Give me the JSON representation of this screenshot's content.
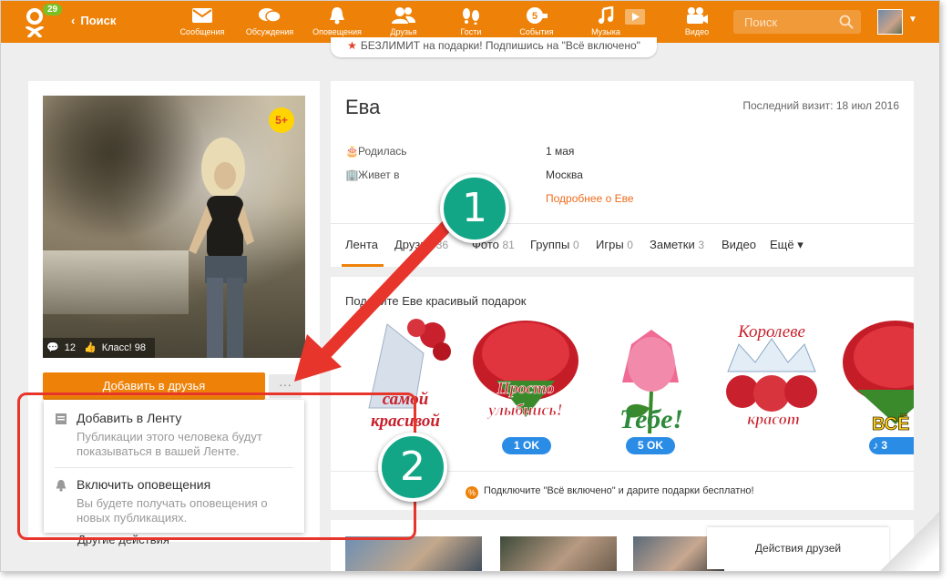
{
  "topbar": {
    "notification_count": "29",
    "back_label": "Поиск",
    "nav": [
      {
        "label": "Сообщения",
        "icon": "envelope-icon"
      },
      {
        "label": "Обсуждения",
        "icon": "chat-bubbles-icon"
      },
      {
        "label": "Оповещения",
        "icon": "bell-icon"
      },
      {
        "label": "Друзья",
        "icon": "friends-icon"
      },
      {
        "label": "Гости",
        "icon": "footprints-icon"
      },
      {
        "label": "События",
        "icon": "events-icon"
      },
      {
        "label": "Музыка",
        "icon": "music-note-icon"
      },
      {
        "label": "Видео",
        "icon": "video-camera-icon"
      }
    ],
    "search_placeholder": "Поиск"
  },
  "promo": {
    "text": "БЕЗЛИМИТ на подарки! Подпишись на \"Всё включено\""
  },
  "profile": {
    "photo_badge": "5+",
    "comments_count": "12",
    "likes_label": "Класс! 98",
    "add_friend_label": "Добавить в друзья",
    "more_label": "···",
    "name": "Ева",
    "last_visit": "Последний визит: 18 июл 2016",
    "born_label": "Родилась",
    "born_value": "1 мая",
    "lives_label": "Живет в",
    "lives_value": "Москва",
    "more_about": "Подробнее о Еве"
  },
  "dropdown": {
    "item1_title": "Добавить в Ленту",
    "item1_desc_line1": "Публикации этого человека будут",
    "item1_desc_line2": "показываться в вашей Ленте.",
    "item2_title": "Включить оповещения",
    "item2_desc_line1": "Вы будете получать оповещения о",
    "item2_desc_line2": "новых публикациях.",
    "other_actions": "Другие действия"
  },
  "tabs": [
    {
      "label": "Лента",
      "count": ""
    },
    {
      "label": "Друзья",
      "count": "36"
    },
    {
      "label": "Фото",
      "count": "81"
    },
    {
      "label": "Группы",
      "count": "0"
    },
    {
      "label": "Игры",
      "count": "0"
    },
    {
      "label": "Заметки",
      "count": "3"
    },
    {
      "label": "Видео",
      "count": ""
    },
    {
      "label": "Ещё ▾",
      "count": ""
    }
  ],
  "gifts": {
    "title": "Подарите Еве красивый подарок",
    "items": [
      {
        "caption": "Самой красивой",
        "badge": ""
      },
      {
        "caption": "Просто улыбнись!",
        "badge": "1 OK"
      },
      {
        "caption": "Тебе!",
        "badge": "5 OK"
      },
      {
        "caption": "Королеве красот",
        "badge": ""
      },
      {
        "caption": "ВСЁ",
        "badge": "3"
      }
    ],
    "footer": "Подключите \"Всё включено\" и дарите подарки бесплатно!"
  },
  "friends_actions": "Действия друзей",
  "callouts": {
    "one": "1",
    "two": "2"
  },
  "colors": {
    "brand_orange": "#ee8208",
    "callout_green": "#12a687",
    "highlight_red": "#e8352c",
    "badge_blue": "#2b8ce6"
  }
}
